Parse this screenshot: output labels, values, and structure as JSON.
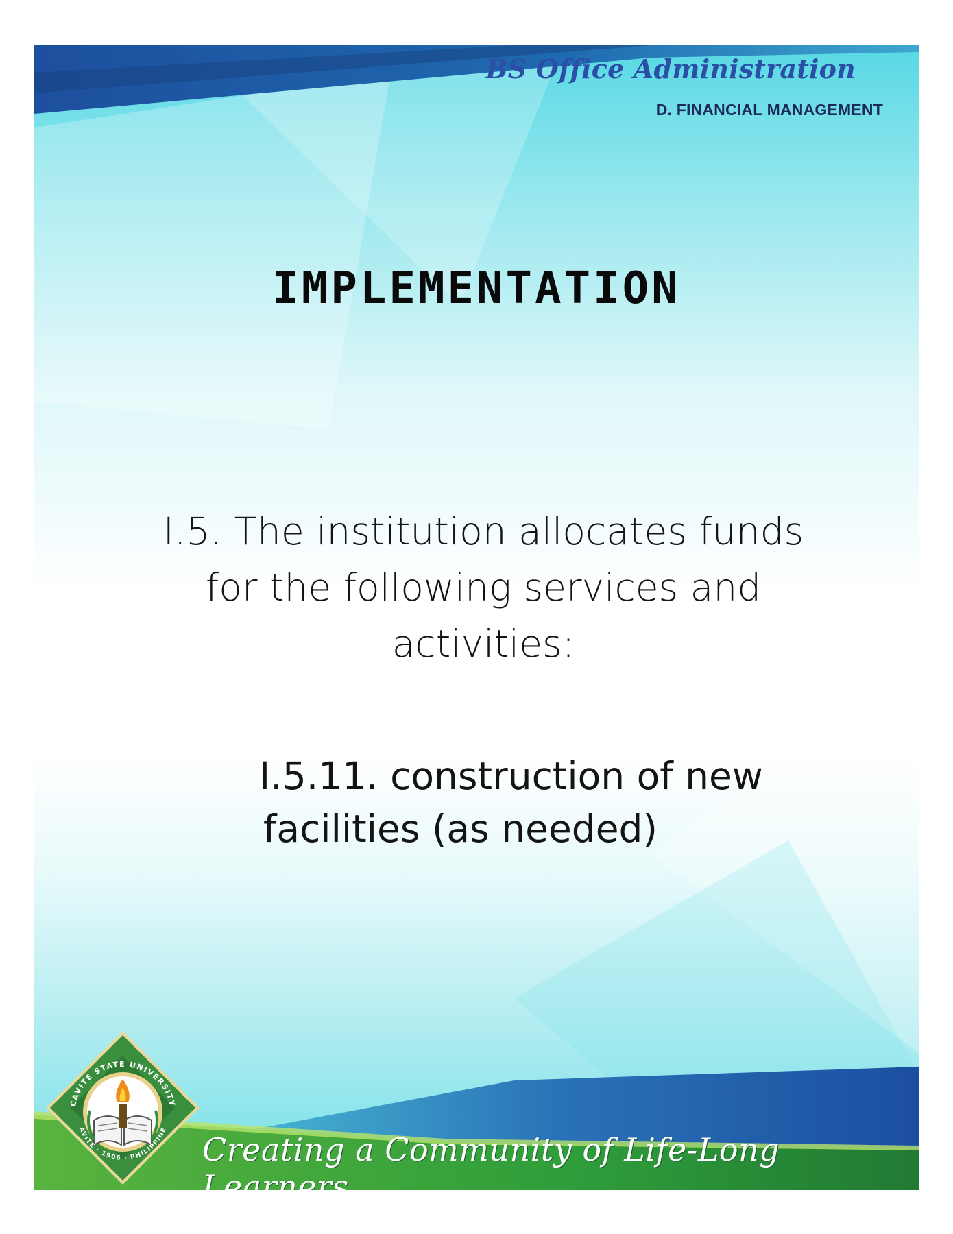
{
  "header": {
    "program": "BS Office Administration",
    "area": "D. FINANCIAL MANAGEMENT"
  },
  "title": "IMPLEMENTATION",
  "criterion": {
    "text": "I.5. The institution allocates funds for the following services and activities:"
  },
  "sub_item": {
    "line1": "I.5.11. construction of new",
    "line2": "facilities (as needed)"
  },
  "footer": {
    "tagline": "Creating a Community of Life-Long Learners",
    "seal": {
      "top_text": "CAVITE STATE UNIVERSITY",
      "bottom_text": "CAVITE · 1906 · PHILIPPINES"
    }
  },
  "colors": {
    "header_blue": "#2b4ea6",
    "band_blue": "#1f56a8",
    "band_green": "#2f9e3a",
    "seal_green": "#3a8f3e"
  }
}
